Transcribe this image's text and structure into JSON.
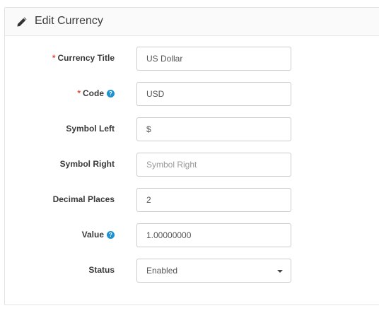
{
  "panel": {
    "title": "Edit Currency"
  },
  "form": {
    "currency_title": {
      "label": "Currency Title",
      "required": "*",
      "value": "US Dollar"
    },
    "code": {
      "label": "Code",
      "required": "*",
      "help": "?",
      "value": "USD"
    },
    "symbol_left": {
      "label": "Symbol Left",
      "value": "$"
    },
    "symbol_right": {
      "label": "Symbol Right",
      "placeholder": "Symbol Right"
    },
    "decimal_places": {
      "label": "Decimal Places",
      "value": "2"
    },
    "value": {
      "label": "Value",
      "help": "?",
      "value": "1.00000000"
    },
    "status": {
      "label": "Status",
      "selected": "Enabled"
    }
  },
  "colors": {
    "required": "#e3503e",
    "help": "#1e91cf",
    "border": "#cccccc"
  },
  "icons": {
    "title": "pencil-icon",
    "help": "question-circle-icon",
    "select": "caret-down-icon"
  }
}
